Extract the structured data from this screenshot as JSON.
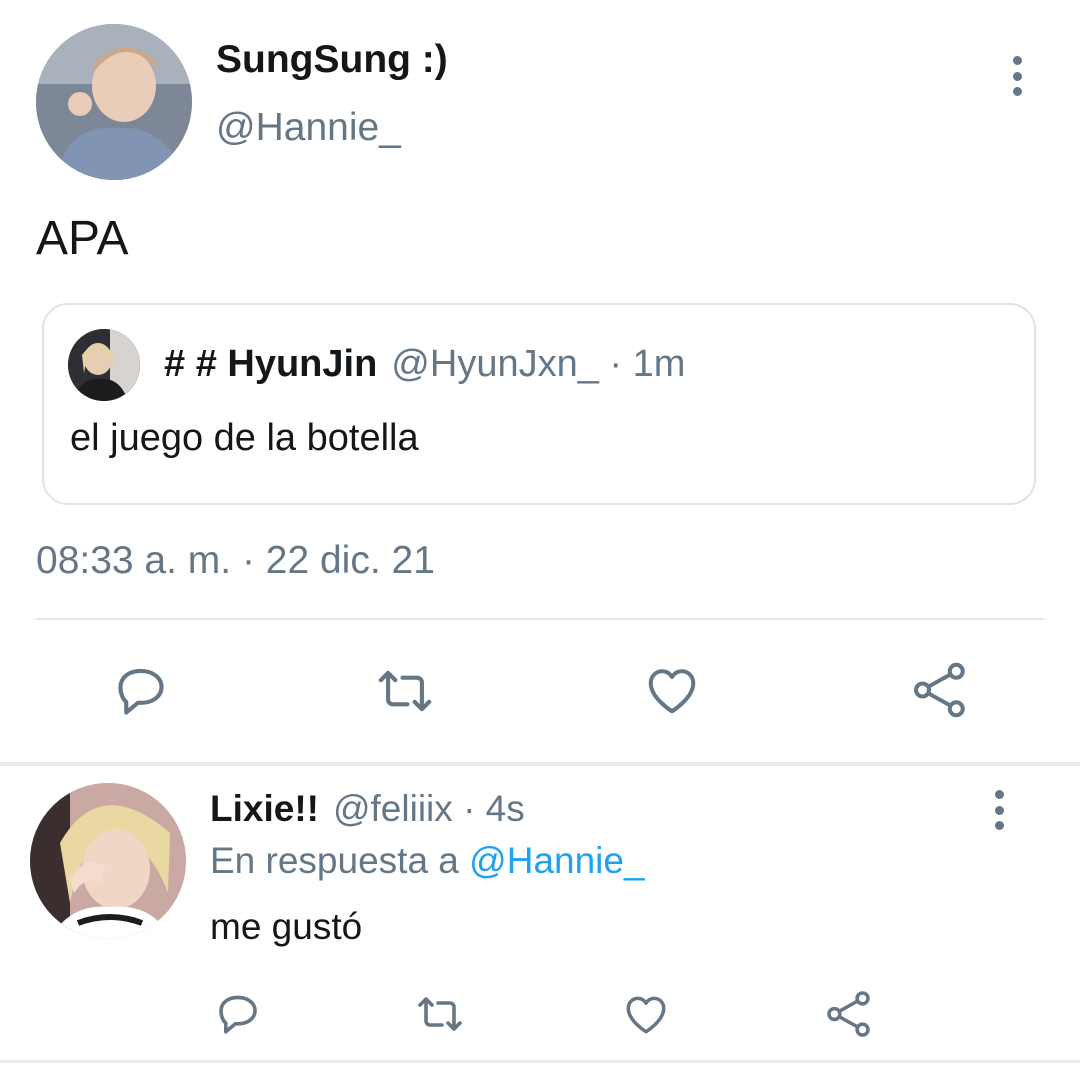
{
  "tweet": {
    "author_name": "SungSung :)",
    "author_handle": "@Hannie_",
    "text": "APA",
    "timestamp": "08:33 a. m. · 22 dic. 21",
    "avatar_icon": "user-avatar-photo",
    "more_icon": "more-vertical-icon"
  },
  "quoted_tweet": {
    "author_name": "# # HyunJin",
    "author_handle": "@HyunJxn_",
    "time_meta": "· 1m",
    "text": "el juego de la botella",
    "avatar_icon": "user-avatar-photo"
  },
  "actions": {
    "icons": [
      "reply-icon",
      "retweet-icon",
      "like-icon",
      "share-icon"
    ],
    "color": "#657786"
  },
  "reply": {
    "author_name": "Lixie!!",
    "author_handle": "@feliiix",
    "time_meta": "· 4s",
    "reply_prefix": "En respuesta a",
    "reply_to": "@Hannie_",
    "text": "me gustó",
    "avatar_icon": "user-avatar-photo",
    "more_icon": "more-vertical-icon"
  },
  "colors": {
    "text": "#14171a",
    "secondary": "#657786",
    "link": "#1da1f2",
    "border": "#e1e8ed"
  }
}
